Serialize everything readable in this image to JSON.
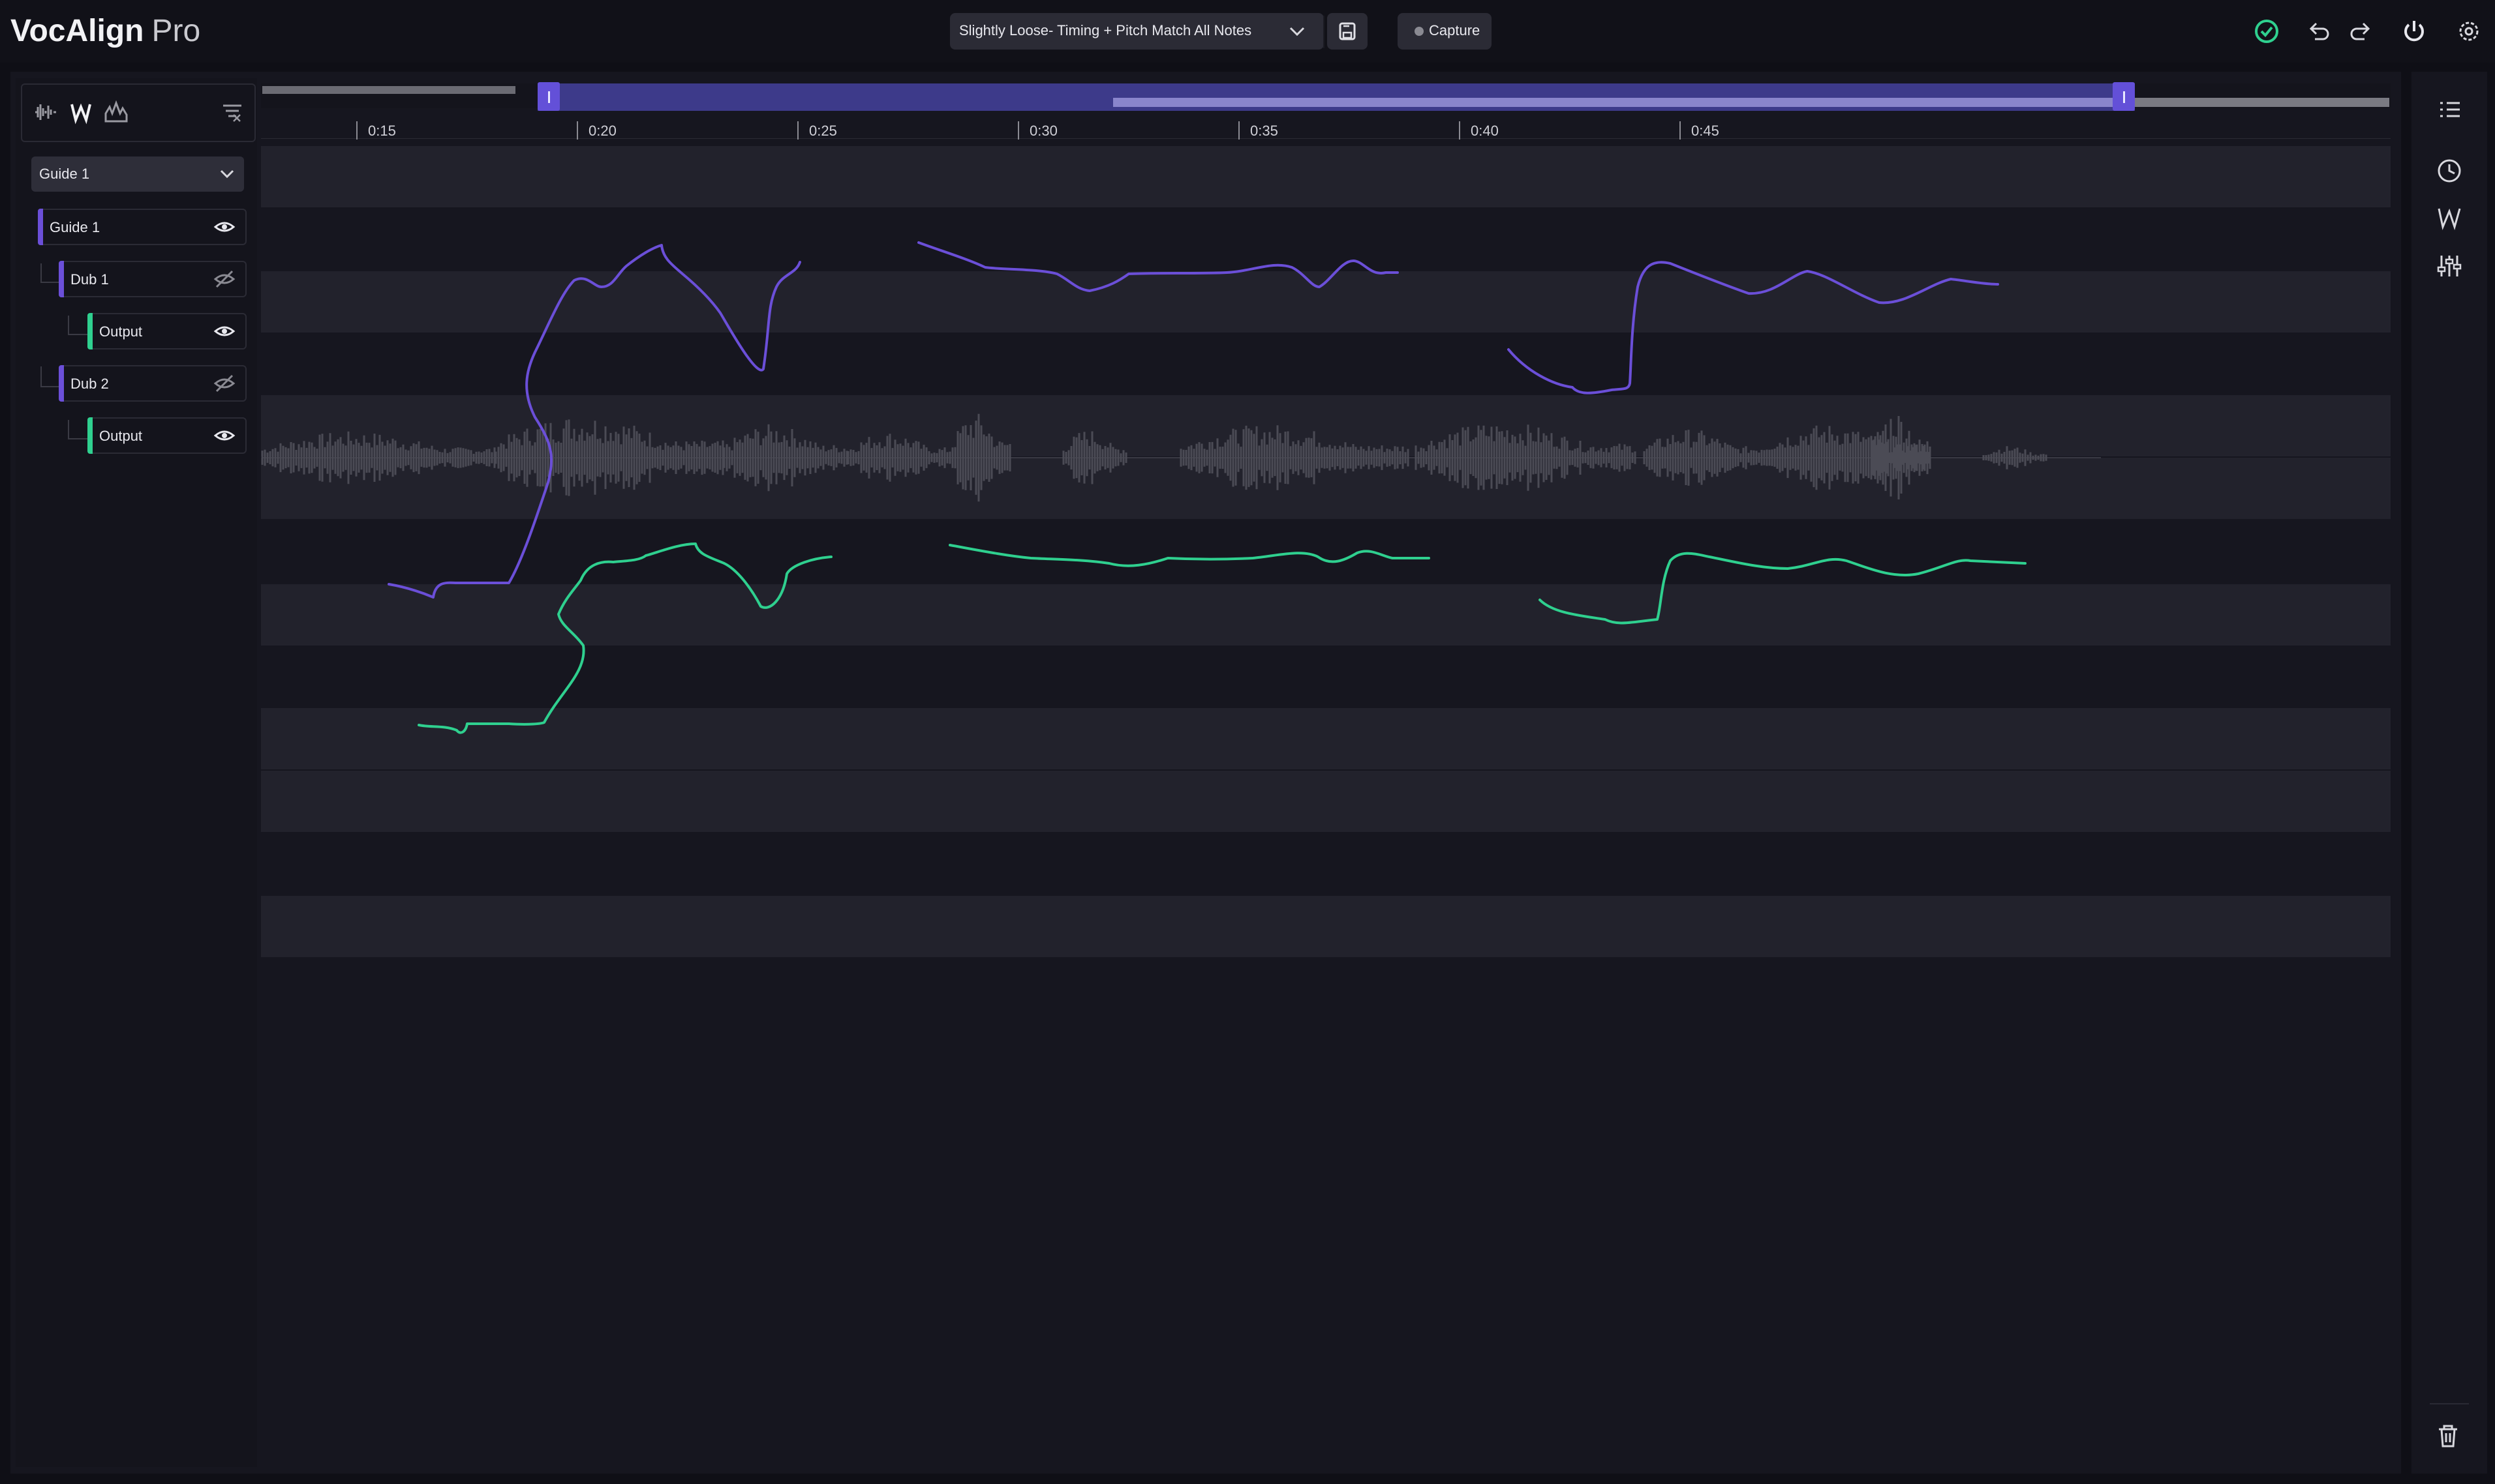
{
  "app": {
    "title": "VocAlign",
    "edition": "Pro"
  },
  "header": {
    "preset_label": "Slightly Loose- Timing + Pitch Match All Notes",
    "capture_label": "Capture"
  },
  "left_panel": {
    "guide_select_value": "Guide 1",
    "tracks": [
      {
        "label": "Guide 1",
        "color": "#6b4fd8"
      },
      {
        "label": "Dub 1",
        "color": "#6b4fd8"
      },
      {
        "label": "Output",
        "color": "#2fd08f"
      },
      {
        "label": "Dub 2",
        "color": "#6b4fd8"
      },
      {
        "label": "Output",
        "color": "#2fd08f"
      }
    ]
  },
  "timeline": {
    "ticks": [
      "0:15",
      "0:20",
      "0:25",
      "0:30",
      "0:35",
      "0:40",
      "0:45"
    ]
  },
  "colors": {
    "accent": "#6b4fd8",
    "output": "#2fd08f",
    "success": "#2fd08f"
  },
  "icons": {
    "view_modes": [
      "waveform-icon",
      "pitch-icon",
      "spectrum-icon"
    ],
    "rail": [
      "list-icon",
      "clock-icon",
      "pitch-icon",
      "sliders-icon",
      "trash-icon"
    ],
    "header_right": [
      "check-circle-icon",
      "undo-icon",
      "redo-icon",
      "power-icon",
      "gear-icon"
    ]
  }
}
